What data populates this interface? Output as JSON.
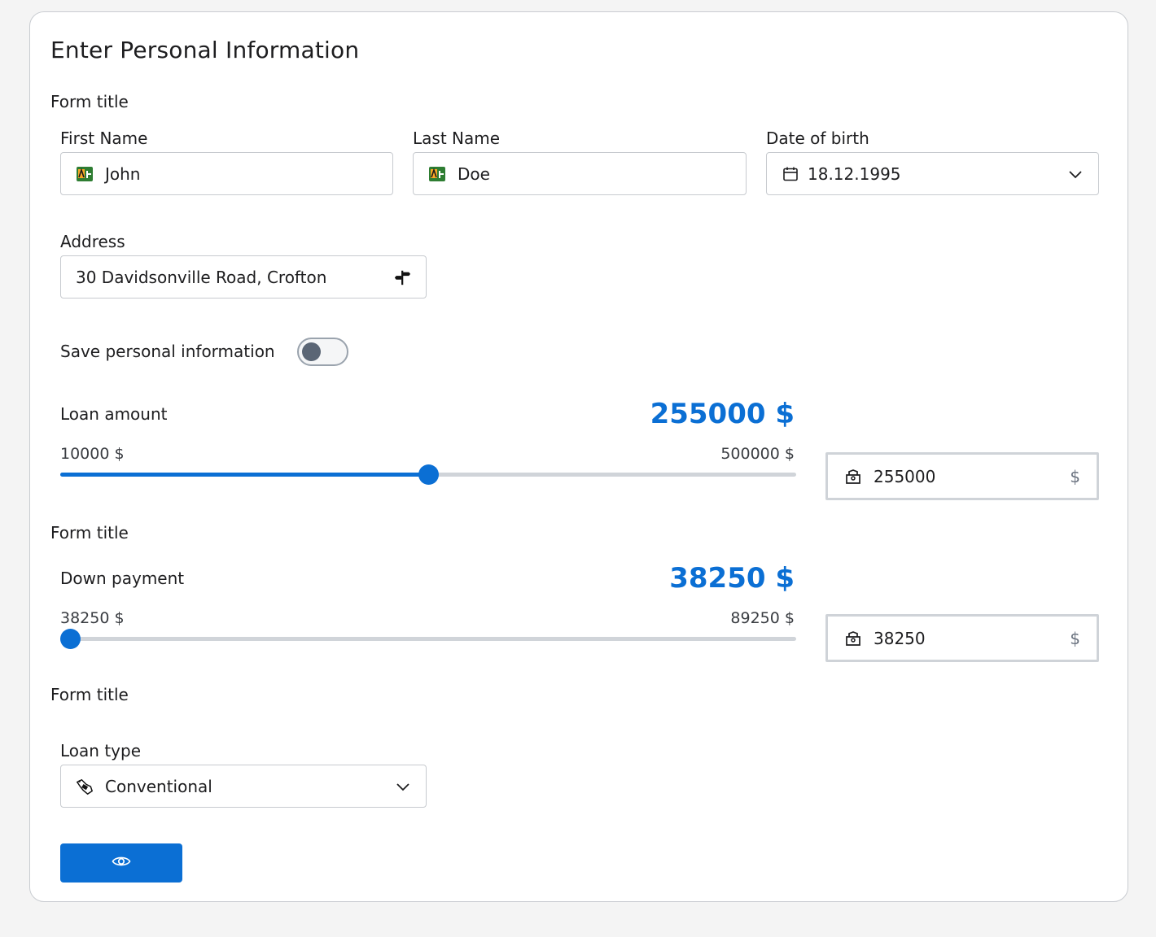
{
  "page": {
    "title": "Enter Personal Information"
  },
  "sections": [
    {
      "title": "Form title"
    },
    {
      "title": "Form title"
    },
    {
      "title": "Form title"
    }
  ],
  "first_name": {
    "label": "First Name",
    "value": "John",
    "icon": "name-badge-icon"
  },
  "last_name": {
    "label": "Last Name",
    "value": "Doe",
    "icon": "name-badge-icon"
  },
  "dob": {
    "label": "Date of birth",
    "value": "18.12.1995",
    "icon": "calendar-icon"
  },
  "address": {
    "label": "Address",
    "value": "30 Davidsonville Road, Crofton",
    "icon": "signpost-icon"
  },
  "save_toggle": {
    "label": "Save personal information",
    "checked": false
  },
  "loan_amount": {
    "label": "Loan amount",
    "display": "255000 $",
    "min_label": "10000 $",
    "max_label": "500000 $",
    "min": 10000,
    "max": 500000,
    "value": 255000,
    "input_value": "255000",
    "unit": "$",
    "icon": "money-bag-icon"
  },
  "down_payment": {
    "label": "Down payment",
    "display": "38250 $",
    "min_label": "38250 $",
    "max_label": "89250 $",
    "min": 38250,
    "max": 89250,
    "value": 38250,
    "input_value": "38250",
    "unit": "$",
    "icon": "money-bag-icon"
  },
  "loan_type": {
    "label": "Loan type",
    "value": "Conventional",
    "icon": "hand-money-icon"
  },
  "submit": {
    "icon": "eye-icon"
  },
  "colors": {
    "accent": "#0b6fd4",
    "track": "#d0d4d9"
  }
}
